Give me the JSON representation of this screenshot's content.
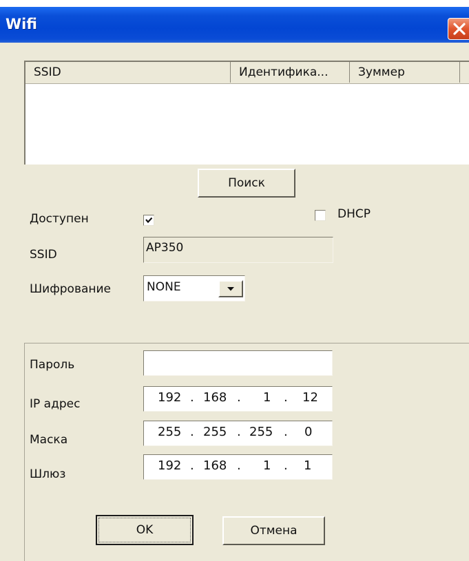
{
  "window": {
    "title": "Wifi"
  },
  "list": {
    "columns": [
      "SSID",
      "Идентифика...",
      "Зуммер"
    ],
    "rows": []
  },
  "search_button": "Поиск",
  "enabled": {
    "label": "Доступен",
    "checked": true
  },
  "dhcp": {
    "label": "DHCP",
    "checked": false
  },
  "ssid": {
    "label": "SSID",
    "value": "AP350"
  },
  "encryption": {
    "label": "Шифрование",
    "value": "NONE"
  },
  "password": {
    "label": "Пароль",
    "value": ""
  },
  "ip": {
    "label": "IP адрес",
    "octets": [
      "192",
      "168",
      "1",
      "12"
    ]
  },
  "mask": {
    "label": "Маска",
    "octets": [
      "255",
      "255",
      "255",
      "0"
    ]
  },
  "gateway": {
    "label": "Шлюз",
    "octets": [
      "192",
      "168",
      "1",
      "1"
    ]
  },
  "buttons": {
    "ok": "OK",
    "cancel": "Отмена"
  },
  "icons": {
    "close": "close-icon",
    "check": "checkmark-icon",
    "dropdown": "chevron-down-icon"
  },
  "colors": {
    "titlebar": "#0346d3",
    "close_button": "#e0552e",
    "dialog_background": "#ece9d8"
  }
}
